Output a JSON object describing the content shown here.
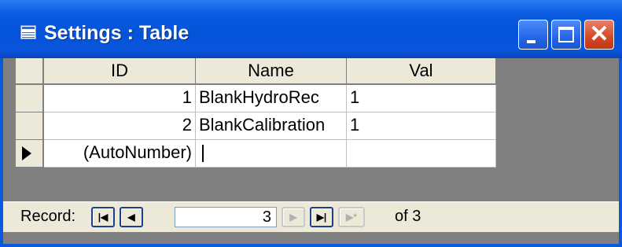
{
  "window": {
    "title": "Settings : Table",
    "minimize_label": "_",
    "maximize_label": "□",
    "close_label": "✕"
  },
  "table": {
    "columns": [
      "ID",
      "Name",
      "Val"
    ],
    "rows": [
      {
        "id": "1",
        "name": "BlankHydroRec",
        "val": "1"
      },
      {
        "id": "2",
        "name": "BlankCalibration",
        "val": "1"
      }
    ],
    "new_row": {
      "id": "(AutoNumber)",
      "name": "",
      "val": ""
    }
  },
  "navigation": {
    "record_label": "Record:",
    "current_record": "3",
    "of_label": "of 3",
    "first_glyph": "|◀",
    "prev_glyph": "◀",
    "next_glyph": "▶",
    "last_glyph": "▶|",
    "new_glyph": "▶*"
  },
  "colors": {
    "titlebar": "#0a5ae0",
    "close_button": "#d44826",
    "grid_background": "#808080"
  }
}
